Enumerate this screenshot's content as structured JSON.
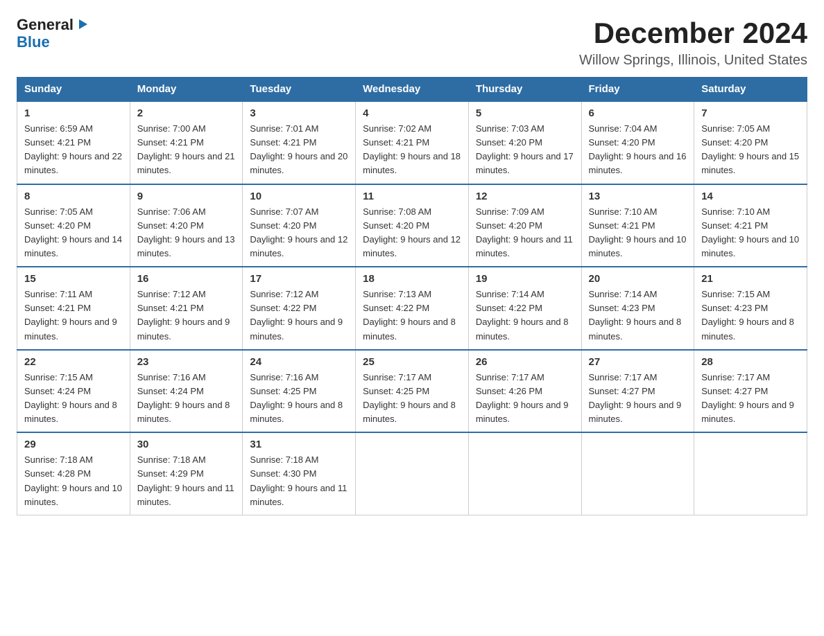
{
  "logo": {
    "line1": "General",
    "arrow": "▶",
    "line2": "Blue"
  },
  "title": "December 2024",
  "subtitle": "Willow Springs, Illinois, United States",
  "days_of_week": [
    "Sunday",
    "Monday",
    "Tuesday",
    "Wednesday",
    "Thursday",
    "Friday",
    "Saturday"
  ],
  "weeks": [
    [
      {
        "day": "1",
        "sunrise": "6:59 AM",
        "sunset": "4:21 PM",
        "daylight": "9 hours and 22 minutes."
      },
      {
        "day": "2",
        "sunrise": "7:00 AM",
        "sunset": "4:21 PM",
        "daylight": "9 hours and 21 minutes."
      },
      {
        "day": "3",
        "sunrise": "7:01 AM",
        "sunset": "4:21 PM",
        "daylight": "9 hours and 20 minutes."
      },
      {
        "day": "4",
        "sunrise": "7:02 AM",
        "sunset": "4:21 PM",
        "daylight": "9 hours and 18 minutes."
      },
      {
        "day": "5",
        "sunrise": "7:03 AM",
        "sunset": "4:20 PM",
        "daylight": "9 hours and 17 minutes."
      },
      {
        "day": "6",
        "sunrise": "7:04 AM",
        "sunset": "4:20 PM",
        "daylight": "9 hours and 16 minutes."
      },
      {
        "day": "7",
        "sunrise": "7:05 AM",
        "sunset": "4:20 PM",
        "daylight": "9 hours and 15 minutes."
      }
    ],
    [
      {
        "day": "8",
        "sunrise": "7:05 AM",
        "sunset": "4:20 PM",
        "daylight": "9 hours and 14 minutes."
      },
      {
        "day": "9",
        "sunrise": "7:06 AM",
        "sunset": "4:20 PM",
        "daylight": "9 hours and 13 minutes."
      },
      {
        "day": "10",
        "sunrise": "7:07 AM",
        "sunset": "4:20 PM",
        "daylight": "9 hours and 12 minutes."
      },
      {
        "day": "11",
        "sunrise": "7:08 AM",
        "sunset": "4:20 PM",
        "daylight": "9 hours and 12 minutes."
      },
      {
        "day": "12",
        "sunrise": "7:09 AM",
        "sunset": "4:20 PM",
        "daylight": "9 hours and 11 minutes."
      },
      {
        "day": "13",
        "sunrise": "7:10 AM",
        "sunset": "4:21 PM",
        "daylight": "9 hours and 10 minutes."
      },
      {
        "day": "14",
        "sunrise": "7:10 AM",
        "sunset": "4:21 PM",
        "daylight": "9 hours and 10 minutes."
      }
    ],
    [
      {
        "day": "15",
        "sunrise": "7:11 AM",
        "sunset": "4:21 PM",
        "daylight": "9 hours and 9 minutes."
      },
      {
        "day": "16",
        "sunrise": "7:12 AM",
        "sunset": "4:21 PM",
        "daylight": "9 hours and 9 minutes."
      },
      {
        "day": "17",
        "sunrise": "7:12 AM",
        "sunset": "4:22 PM",
        "daylight": "9 hours and 9 minutes."
      },
      {
        "day": "18",
        "sunrise": "7:13 AM",
        "sunset": "4:22 PM",
        "daylight": "9 hours and 8 minutes."
      },
      {
        "day": "19",
        "sunrise": "7:14 AM",
        "sunset": "4:22 PM",
        "daylight": "9 hours and 8 minutes."
      },
      {
        "day": "20",
        "sunrise": "7:14 AM",
        "sunset": "4:23 PM",
        "daylight": "9 hours and 8 minutes."
      },
      {
        "day": "21",
        "sunrise": "7:15 AM",
        "sunset": "4:23 PM",
        "daylight": "9 hours and 8 minutes."
      }
    ],
    [
      {
        "day": "22",
        "sunrise": "7:15 AM",
        "sunset": "4:24 PM",
        "daylight": "9 hours and 8 minutes."
      },
      {
        "day": "23",
        "sunrise": "7:16 AM",
        "sunset": "4:24 PM",
        "daylight": "9 hours and 8 minutes."
      },
      {
        "day": "24",
        "sunrise": "7:16 AM",
        "sunset": "4:25 PM",
        "daylight": "9 hours and 8 minutes."
      },
      {
        "day": "25",
        "sunrise": "7:17 AM",
        "sunset": "4:25 PM",
        "daylight": "9 hours and 8 minutes."
      },
      {
        "day": "26",
        "sunrise": "7:17 AM",
        "sunset": "4:26 PM",
        "daylight": "9 hours and 9 minutes."
      },
      {
        "day": "27",
        "sunrise": "7:17 AM",
        "sunset": "4:27 PM",
        "daylight": "9 hours and 9 minutes."
      },
      {
        "day": "28",
        "sunrise": "7:17 AM",
        "sunset": "4:27 PM",
        "daylight": "9 hours and 9 minutes."
      }
    ],
    [
      {
        "day": "29",
        "sunrise": "7:18 AM",
        "sunset": "4:28 PM",
        "daylight": "9 hours and 10 minutes."
      },
      {
        "day": "30",
        "sunrise": "7:18 AM",
        "sunset": "4:29 PM",
        "daylight": "9 hours and 11 minutes."
      },
      {
        "day": "31",
        "sunrise": "7:18 AM",
        "sunset": "4:30 PM",
        "daylight": "9 hours and 11 minutes."
      },
      null,
      null,
      null,
      null
    ]
  ]
}
